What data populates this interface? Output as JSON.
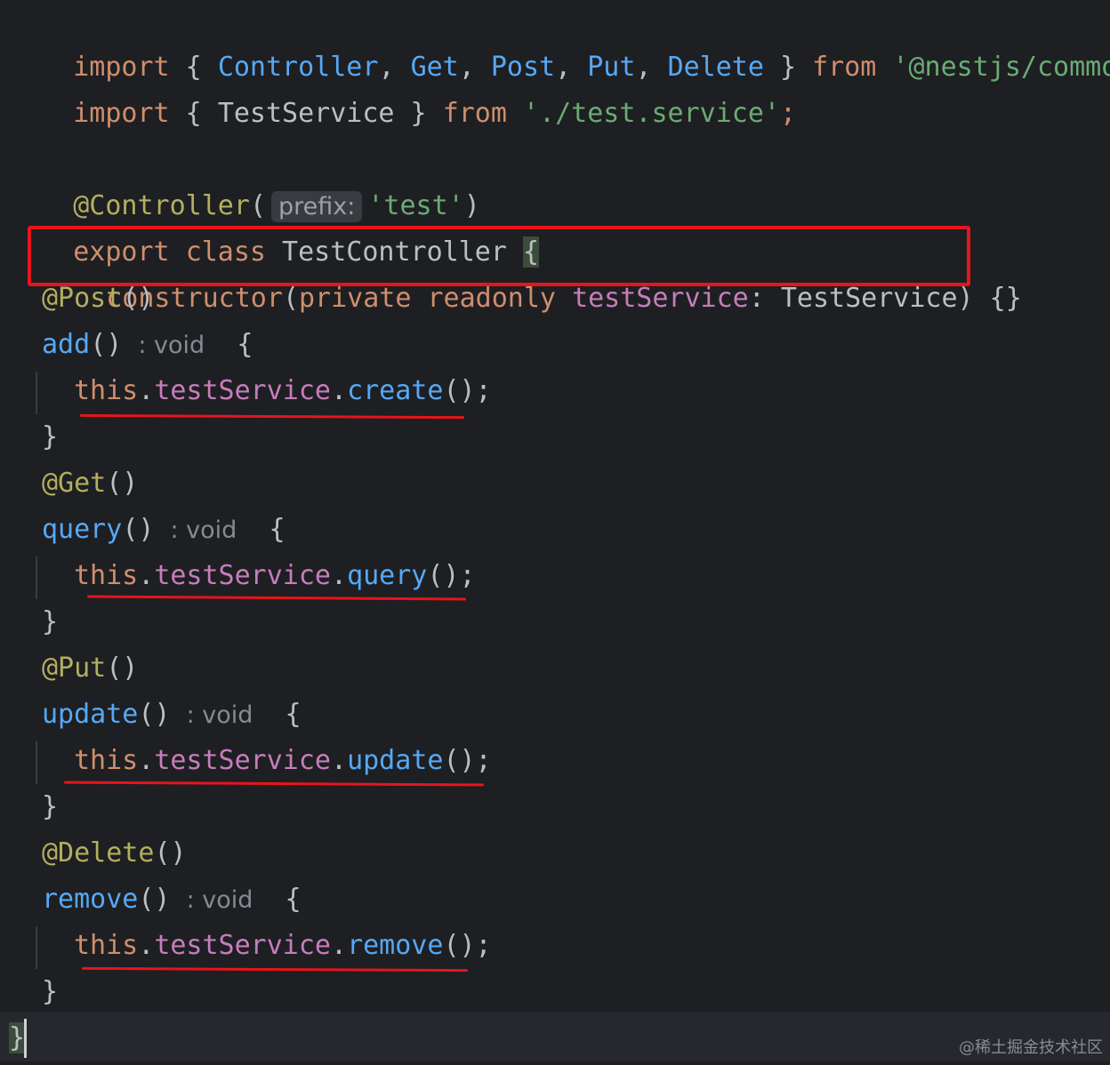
{
  "code": {
    "import1": {
      "kw_import": "import",
      "lbrace": " { ",
      "controller": "Controller",
      "c1": ", ",
      "get": "Get",
      "c2": ", ",
      "post": "Post",
      "c3": ", ",
      "put": "Put",
      "c4": ", ",
      "del": "Delete",
      "rbrace": " } ",
      "kw_from": "from",
      "sp": " ",
      "module": "'@nestjs/common'",
      "semi": ";"
    },
    "import2": {
      "kw_import": "import",
      "lbrace": " { ",
      "name": "TestService",
      "rbrace": " } ",
      "kw_from": "from",
      "sp": " ",
      "module": "'./test.service'",
      "semi": ";"
    },
    "decorator": {
      "name": "@Controller",
      "open": "(",
      "hint": "prefix:",
      "arg": "'test'",
      "close": ")"
    },
    "class_decl": {
      "kw_export": "export",
      "sp1": " ",
      "kw_class": "class",
      "rest": " TestController ",
      "brace": "{"
    },
    "ctor": {
      "kw": "constructor",
      "open": "(",
      "kw_private": "private",
      "sp": " ",
      "kw_readonly": "readonly",
      "sp2": " ",
      "field": "testService",
      "rest": ": TestService) {}"
    },
    "methods": [
      {
        "decorator": "@Post",
        "parens": "()",
        "name": "add",
        "sig": "()",
        "hint": ": void",
        "brace": "{",
        "this": "this",
        "dot1": ".",
        "field": "testService",
        "dot2": ".",
        "call": "create",
        "tail": "();",
        "close": "}"
      },
      {
        "decorator": "@Get",
        "parens": "()",
        "name": "query",
        "sig": "()",
        "hint": ": void",
        "brace": "{",
        "this": "this",
        "dot1": ".",
        "field": "testService",
        "dot2": ".",
        "call": "query",
        "tail": "();",
        "close": "}"
      },
      {
        "decorator": "@Put",
        "parens": "()",
        "name": "update",
        "sig": "()",
        "hint": ": void",
        "brace": "{",
        "this": "this",
        "dot1": ".",
        "field": "testService",
        "dot2": ".",
        "call": "update",
        "tail": "();",
        "close": "}"
      },
      {
        "decorator": "@Delete",
        "parens": "()",
        "name": "remove",
        "sig": "()",
        "hint": ": void",
        "brace": "{",
        "this": "this",
        "dot1": ".",
        "field": "testService",
        "dot2": ".",
        "call": "remove",
        "tail": "();",
        "close": "}"
      }
    ],
    "class_close": "}"
  },
  "watermark": "@稀土掘金技术社区",
  "colors": {
    "background": "#1e1f22",
    "keyword": "#cf8e6d",
    "function": "#56a8f5",
    "string": "#6aab73",
    "annotation": "#b3ae60",
    "field": "#c77dbb",
    "text": "#bcbec4",
    "highlight": "#e8141c"
  }
}
